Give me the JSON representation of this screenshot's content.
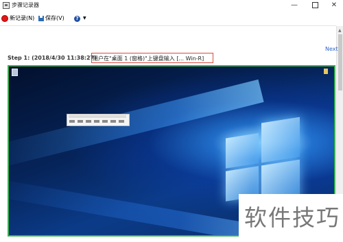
{
  "window": {
    "title": "步骤记录器",
    "controls": {
      "minimize": "—",
      "maximize": "",
      "close": "✕"
    }
  },
  "toolbar": {
    "new_record": "新记录(N)",
    "save": "保存(V)",
    "help_icon_glyph": "?",
    "help_caret": "▼"
  },
  "navigation": {
    "next": "Next"
  },
  "step": {
    "heading": "Step 1: (2018/4/30 11:38:27)",
    "description": "用户在\"桌面  1 (窗格)\"上键盘输入 [... Win-R]"
  },
  "scrollbar": {
    "up_arrow": "▲"
  },
  "watermark": {
    "text": "软件技巧"
  },
  "colors": {
    "accent_link": "#2b64c9",
    "highlight_border": "#d84a3f",
    "screenshot_border": "#3ab24f",
    "record_button": "#e01818"
  }
}
